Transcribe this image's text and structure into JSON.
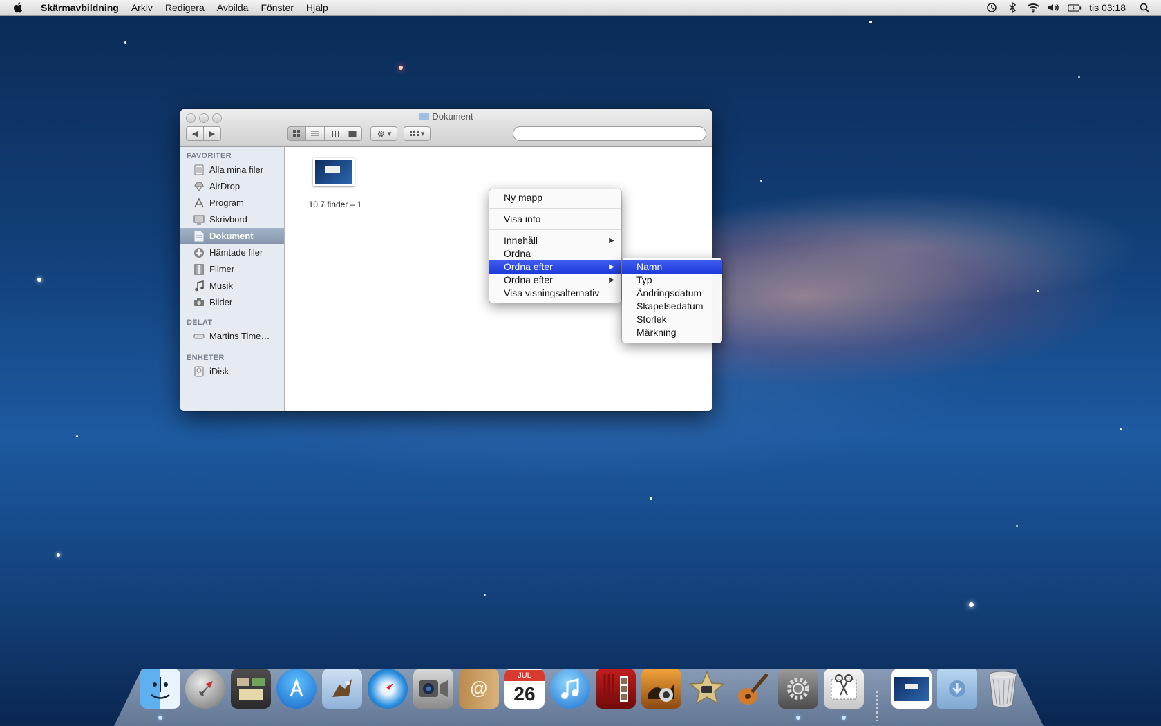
{
  "menubar": {
    "app_name": "Skärmavbildning",
    "menus": [
      "Arkiv",
      "Redigera",
      "Avbilda",
      "Fönster",
      "Hjälp"
    ],
    "clock": "tis 03:18",
    "status_icons": [
      "time-machine-icon",
      "bluetooth-icon",
      "wifi-icon",
      "volume-icon",
      "battery-icon"
    ]
  },
  "window": {
    "title": "Dokument",
    "search_placeholder": "",
    "sidebar": {
      "favorites_header": "FAVORITER",
      "favorites": [
        "Alla mina filer",
        "AirDrop",
        "Program",
        "Skrivbord",
        "Dokument",
        "Hämtade filer",
        "Filmer",
        "Musik",
        "Bilder"
      ],
      "selected": "Dokument",
      "shared_header": "DELAT",
      "shared": [
        "Martins Time…"
      ],
      "devices_header": "ENHETER",
      "devices": [
        "iDisk"
      ]
    },
    "file": {
      "name": "10.7 finder – 1"
    }
  },
  "context_menu": {
    "items": [
      "Ny mapp",
      "Visa info",
      "Innehåll",
      "Ordna",
      "Ordna efter",
      "Ordna efter",
      "Visa visningsalternativ"
    ],
    "highlighted": "Ordna efter"
  },
  "submenu": {
    "items": [
      "Namn",
      "Typ",
      "Ändringsdatum",
      "Skapelsedatum",
      "Storlek",
      "Märkning"
    ],
    "highlighted": "Namn"
  },
  "dock": {
    "apps": [
      "Finder",
      "Launchpad",
      "Mission Control",
      "App Store",
      "Mail",
      "Safari",
      "FaceTime",
      "Adressbok",
      "iCal",
      "iTunes",
      "Photo Booth",
      "iPhoto",
      "iMovie",
      "GarageBand",
      "Systeminställningar",
      "Skärmavbildning"
    ],
    "calendar_month": "JUL",
    "calendar_day": "26",
    "right_items": [
      "Dokument-stack",
      "Hämtade filer-stack",
      "Papperskorg"
    ],
    "colors": {
      "accent": "#1d3bd9",
      "sidebar": "#e6ebf1"
    }
  }
}
